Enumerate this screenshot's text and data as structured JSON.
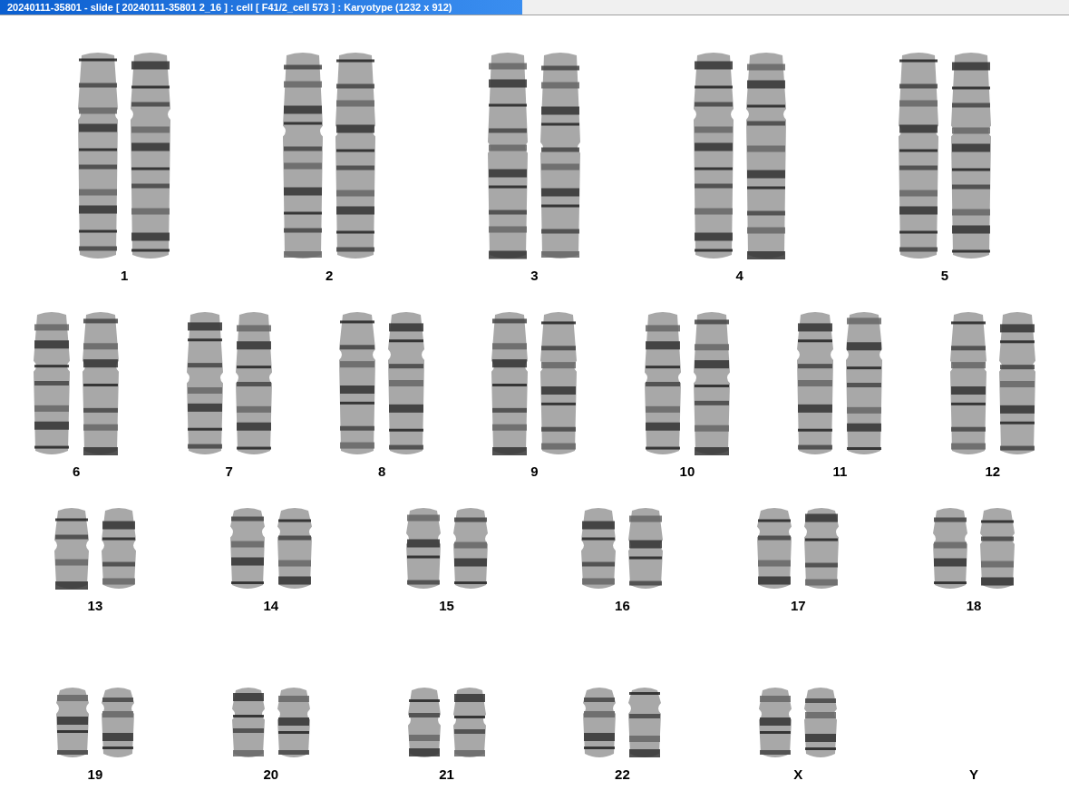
{
  "window": {
    "title": "20240111-35801 - slide [ 20240111-35801 2_16 ] : cell [ F41/2_cell 573 ] : Karyotype  (1232 x 912)"
  },
  "rows": [
    {
      "pairs": [
        {
          "label": "1",
          "kind": "pair"
        },
        {
          "label": "2",
          "kind": "pair"
        },
        {
          "label": "3",
          "kind": "pair"
        },
        {
          "label": "4",
          "kind": "pair"
        },
        {
          "label": "5",
          "kind": "pair"
        }
      ]
    },
    {
      "pairs": [
        {
          "label": "6",
          "kind": "pair"
        },
        {
          "label": "7",
          "kind": "pair"
        },
        {
          "label": "8",
          "kind": "pair"
        },
        {
          "label": "9",
          "kind": "pair"
        },
        {
          "label": "10",
          "kind": "pair"
        },
        {
          "label": "11",
          "kind": "pair"
        },
        {
          "label": "12",
          "kind": "pair"
        }
      ]
    },
    {
      "pairs": [
        {
          "label": "13",
          "kind": "pair"
        },
        {
          "label": "14",
          "kind": "pair"
        },
        {
          "label": "15",
          "kind": "pair"
        },
        {
          "label": "16",
          "kind": "pair"
        },
        {
          "label": "17",
          "kind": "pair"
        },
        {
          "label": "18",
          "kind": "pair"
        }
      ]
    },
    {
      "pairs": [
        {
          "label": "19",
          "kind": "pair"
        },
        {
          "label": "20",
          "kind": "pair"
        },
        {
          "label": "21",
          "kind": "pair"
        },
        {
          "label": "22",
          "kind": "pair"
        },
        {
          "label": "X",
          "kind": "pair"
        },
        {
          "label": "Y",
          "kind": "none"
        }
      ]
    }
  ]
}
